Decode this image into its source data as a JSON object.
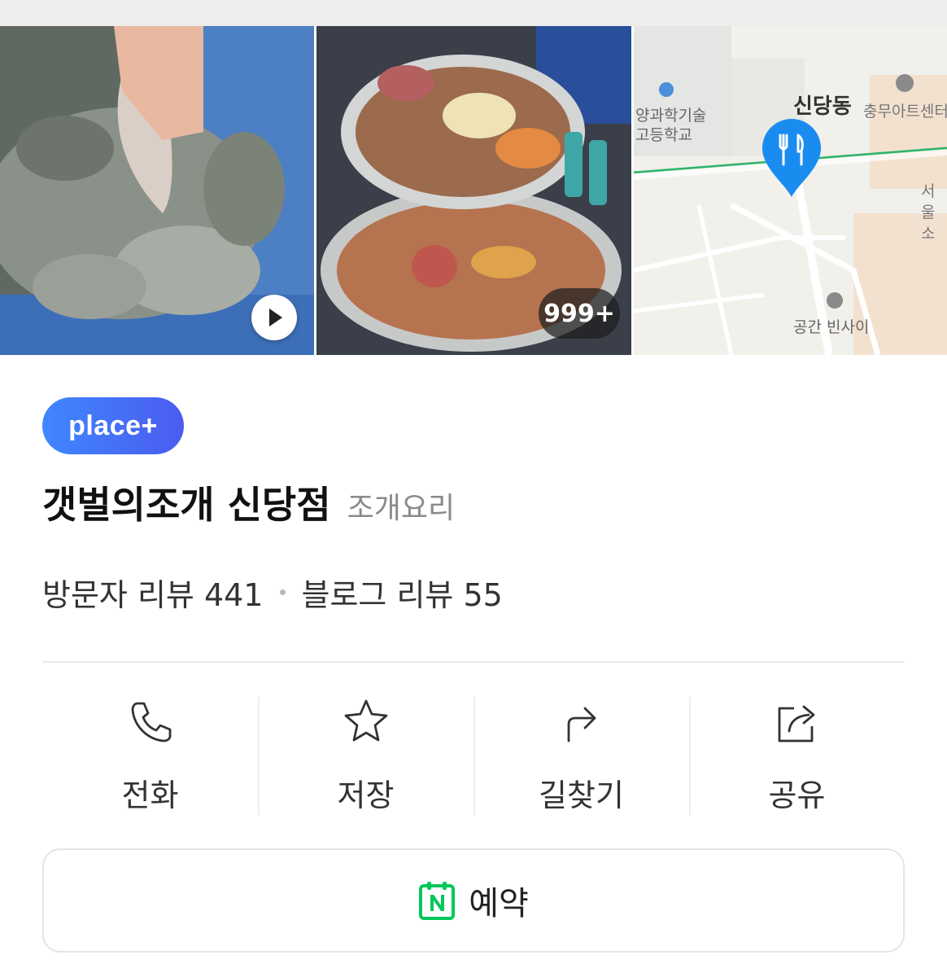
{
  "gallery": {
    "photo_count": "999+",
    "map_labels": {
      "school": "양과학기술\n고등학교",
      "dong": "신당동",
      "art_center": "충무아트센터",
      "seoul": "서울\n소",
      "space": "공간 빈사이"
    }
  },
  "badge": {
    "label": "place+"
  },
  "place": {
    "name": "갯벌의조개 신당점",
    "category": "조개요리"
  },
  "reviews": {
    "visitor": "방문자 리뷰 441",
    "blog": "블로그 리뷰 55"
  },
  "actions": [
    {
      "label": "전화",
      "icon": "phone-icon"
    },
    {
      "label": "저장",
      "icon": "star-icon"
    },
    {
      "label": "길찾기",
      "icon": "directions-icon"
    },
    {
      "label": "공유",
      "icon": "share-icon"
    }
  ],
  "reserve": {
    "label": "예약",
    "icon": "naver-booking-icon"
  },
  "colors": {
    "badge_start": "#3f86ff",
    "badge_end": "#4b5cf0",
    "map_pin": "#1a8cf0",
    "naver_green": "#03c75a"
  }
}
